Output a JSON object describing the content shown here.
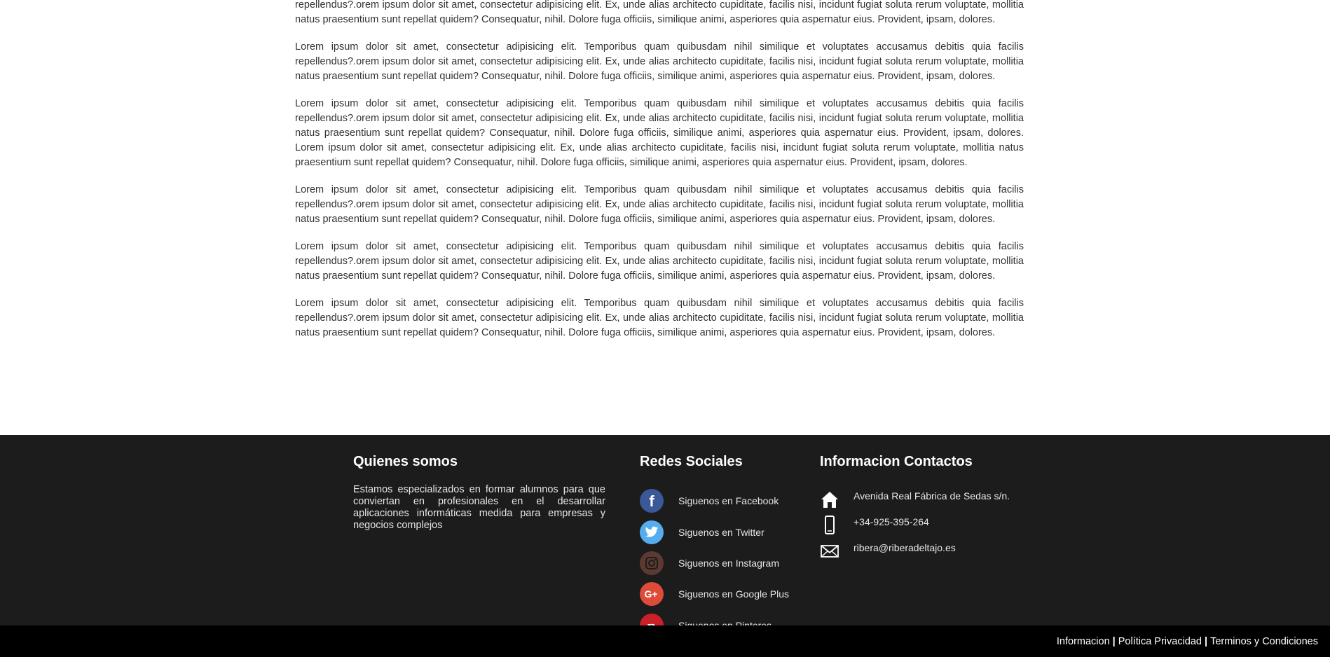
{
  "paragraphs": [
    "repellendus?.orem ipsum dolor sit amet, consectetur adipisicing elit. Ex, unde alias architecto cupiditate, facilis nisi, incidunt fugiat soluta rerum voluptate, mollitia natus praesentium sunt repellat quidem? Consequatur, nihil. Dolore fuga officiis, similique animi, asperiores quia aspernatur eius. Provident, ipsam, dolores.",
    "Lorem ipsum dolor sit amet, consectetur adipisicing elit. Temporibus quam quibusdam nihil similique et voluptates accusamus debitis quia facilis repellendus?.orem ipsum dolor sit amet, consectetur adipisicing elit. Ex, unde alias architecto cupiditate, facilis nisi, incidunt fugiat soluta rerum voluptate, mollitia natus praesentium sunt repellat quidem? Consequatur, nihil. Dolore fuga officiis, similique animi, asperiores quia aspernatur eius. Provident, ipsam, dolores.",
    "Lorem ipsum dolor sit amet, consectetur adipisicing elit. Temporibus quam quibusdam nihil similique et voluptates accusamus debitis quia facilis repellendus?.orem ipsum dolor sit amet, consectetur adipisicing elit. Ex, unde alias architecto cupiditate, facilis nisi, incidunt fugiat soluta rerum voluptate, mollitia natus praesentium sunt repellat quidem? Consequatur, nihil. Dolore fuga officiis, similique animi, asperiores quia aspernatur eius. Provident, ipsam, dolores. Lorem ipsum dolor sit amet, consectetur adipisicing elit. Ex, unde alias architecto cupiditate, facilis nisi, incidunt fugiat soluta rerum voluptate, mollitia natus praesentium sunt repellat quidem? Consequatur, nihil. Dolore fuga officiis, similique animi, asperiores quia aspernatur eius. Provident, ipsam, dolores.",
    "Lorem ipsum dolor sit amet, consectetur adipisicing elit. Temporibus quam quibusdam nihil similique et voluptates accusamus debitis quia facilis repellendus?.orem ipsum dolor sit amet, consectetur adipisicing elit. Ex, unde alias architecto cupiditate, facilis nisi, incidunt fugiat soluta rerum voluptate, mollitia natus praesentium sunt repellat quidem? Consequatur, nihil. Dolore fuga officiis, similique animi, asperiores quia aspernatur eius. Provident, ipsam, dolores.",
    "Lorem ipsum dolor sit amet, consectetur adipisicing elit. Temporibus quam quibusdam nihil similique et voluptates accusamus debitis quia facilis repellendus?.orem ipsum dolor sit amet, consectetur adipisicing elit. Ex, unde alias architecto cupiditate, facilis nisi, incidunt fugiat soluta rerum voluptate, mollitia natus praesentium sunt repellat quidem? Consequatur, nihil. Dolore fuga officiis, similique animi, asperiores quia aspernatur eius. Provident, ipsam, dolores.",
    "Lorem ipsum dolor sit amet, consectetur adipisicing elit. Temporibus quam quibusdam nihil similique et voluptates accusamus debitis quia facilis repellendus?.orem ipsum dolor sit amet, consectetur adipisicing elit. Ex, unde alias architecto cupiditate, facilis nisi, incidunt fugiat soluta rerum voluptate, mollitia natus praesentium sunt repellat quidem? Consequatur, nihil. Dolore fuga officiis, similique animi, asperiores quia aspernatur eius. Provident, ipsam, dolores."
  ],
  "footer": {
    "about": {
      "title": "Quienes somos",
      "text": "Estamos especializados en formar alumnos para que conviertan en profesionales en el desarrollar aplicaciones informáticas medida para empresas y negocios complejos"
    },
    "social": {
      "title": "Redes Sociales",
      "items": [
        {
          "label": "Siguenos en Facebook",
          "icon": "facebook-icon",
          "color": "#3b5998"
        },
        {
          "label": "Siguenos en Twitter",
          "icon": "twitter-icon",
          "color": "#55acee"
        },
        {
          "label": "Siguenos en Instagram",
          "icon": "instagram-icon",
          "color": "#5d3a31"
        },
        {
          "label": "Siguenos en Google Plus",
          "icon": "google-plus-icon",
          "color": "#dd4b39"
        },
        {
          "label": "Siguenos en Pinteres",
          "icon": "pinterest-icon",
          "color": "#cb2027"
        }
      ]
    },
    "contact": {
      "title": "Informacion Contactos",
      "items": [
        {
          "label": "Avenida Real Fábrica de Sedas s/n.",
          "icon": "home-icon"
        },
        {
          "label": "+34-925-395-264",
          "icon": "phone-icon"
        },
        {
          "label": "ribera@riberadeltajo.es",
          "icon": "envelope-icon"
        }
      ]
    }
  },
  "legal": {
    "links": [
      "Informacion",
      "Política Privacidad",
      "Terminos y Condiciones"
    ],
    "separator": "|"
  }
}
